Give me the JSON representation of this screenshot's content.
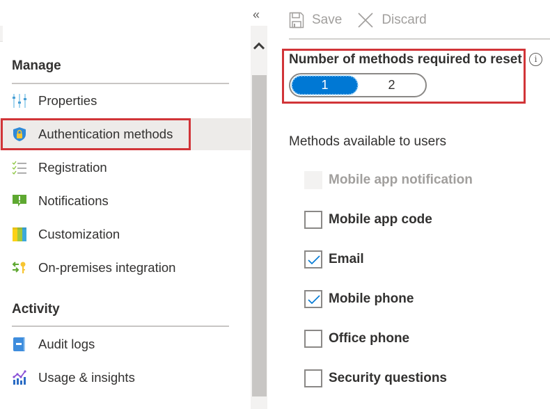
{
  "nav": {
    "collapse_label": "«",
    "sections": [
      {
        "header": "Manage",
        "items": [
          {
            "label": "Properties",
            "icon": "properties-icon"
          },
          {
            "label": "Authentication methods",
            "icon": "shield-lock-icon",
            "selected": true
          },
          {
            "label": "Registration",
            "icon": "checklist-icon"
          },
          {
            "label": "Notifications",
            "icon": "notification-icon"
          },
          {
            "label": "Customization",
            "icon": "customization-icon"
          },
          {
            "label": "On-premises integration",
            "icon": "sync-key-icon"
          }
        ]
      },
      {
        "header": "Activity",
        "items": [
          {
            "label": "Audit logs",
            "icon": "audit-log-icon"
          },
          {
            "label": "Usage & insights",
            "icon": "insights-chart-icon"
          }
        ]
      }
    ]
  },
  "toolbar": {
    "save_label": "Save",
    "discard_label": "Discard"
  },
  "settings": {
    "required_label": "Number of methods required to reset",
    "options": [
      "1",
      "2"
    ],
    "selected_option": "1",
    "methods_label": "Methods available to users",
    "methods": [
      {
        "label": "Mobile app notification",
        "checked": false,
        "disabled": true
      },
      {
        "label": "Mobile app code",
        "checked": false,
        "disabled": false
      },
      {
        "label": "Email",
        "checked": true,
        "disabled": false
      },
      {
        "label": "Mobile phone",
        "checked": true,
        "disabled": false
      },
      {
        "label": "Office phone",
        "checked": false,
        "disabled": false
      },
      {
        "label": "Security questions",
        "checked": false,
        "disabled": false
      }
    ]
  },
  "colors": {
    "accent": "#0078d4",
    "highlight": "#d13438",
    "selected_bg": "#edebe9"
  }
}
